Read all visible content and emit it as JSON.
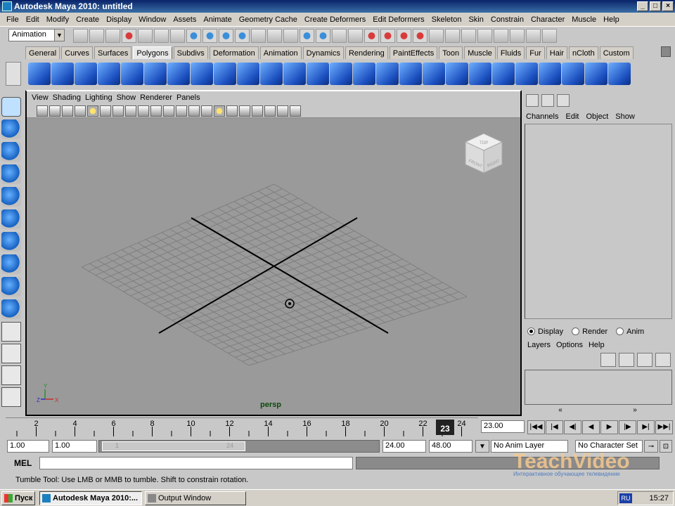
{
  "window": {
    "title": "Autodesk Maya 2010: untitled"
  },
  "menubar": [
    "File",
    "Edit",
    "Modify",
    "Create",
    "Display",
    "Window",
    "Assets",
    "Animate",
    "Geometry Cache",
    "Create Deformers",
    "Edit Deformers",
    "Skeleton",
    "Skin",
    "Constrain",
    "Character",
    "Muscle",
    "Help"
  ],
  "statusline": {
    "mode": "Animation"
  },
  "shelf_tabs": [
    "General",
    "Curves",
    "Surfaces",
    "Polygons",
    "Subdivs",
    "Deformation",
    "Animation",
    "Dynamics",
    "Rendering",
    "PaintEffects",
    "Toon",
    "Muscle",
    "Fluids",
    "Fur",
    "Hair",
    "nCloth",
    "Custom"
  ],
  "shelf_active": "Polygons",
  "viewport": {
    "menu": [
      "View",
      "Shading",
      "Lighting",
      "Show",
      "Renderer",
      "Panels"
    ],
    "camera": "persp",
    "viewcube": {
      "top": "TOP",
      "front": "FRONT",
      "right": "RIGHT"
    },
    "axis": {
      "y": "Y",
      "z": "Z",
      "x": "X"
    }
  },
  "channel_box": {
    "menu": [
      "Channels",
      "Edit",
      "Object",
      "Show"
    ]
  },
  "layer_editor": {
    "modes": [
      "Display",
      "Render",
      "Anim"
    ],
    "selected_mode": "Display",
    "menu": [
      "Layers",
      "Options",
      "Help"
    ]
  },
  "timeline": {
    "ticks": [
      "2",
      "4",
      "6",
      "8",
      "10",
      "12",
      "14",
      "16",
      "18",
      "20",
      "22",
      "24"
    ],
    "current_frame_marker": "23",
    "current_frame_field": "23.00"
  },
  "range": {
    "start": "1.00",
    "playback_start": "1.00",
    "slider_start": "1",
    "slider_end": "24",
    "playback_end": "24.00",
    "end": "48.00",
    "anim_layer": "No Anim Layer",
    "character_set": "No Character Set"
  },
  "command_line": {
    "label": "MEL"
  },
  "help_line": "Tumble Tool: Use LMB or MMB to tumble. Shift to constrain rotation.",
  "watermark": {
    "brand": "TeachVideo",
    "tagline": "Интерактивное обучающее телевидение"
  },
  "taskbar": {
    "start": "Пуск",
    "tasks": [
      "Autodesk Maya 2010:...",
      "Output Window"
    ],
    "lang": "RU",
    "clock": "15:27"
  },
  "colors": {
    "titlebar": "#0a246a",
    "viewport_bg": "#9a9a9a",
    "timeline_marker": "#222222"
  }
}
